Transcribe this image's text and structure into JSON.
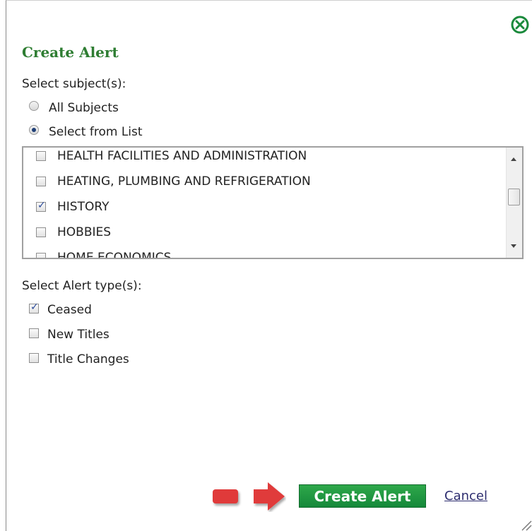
{
  "dialog": {
    "title": "Create Alert",
    "subjects_label": "Select subject(s):",
    "subject_options": [
      {
        "label": "All Subjects",
        "selected": false
      },
      {
        "label": "Select from List",
        "selected": true
      }
    ],
    "subject_list": [
      {
        "label": "HEALTH FACILITIES AND ADMINISTRATION",
        "checked": false
      },
      {
        "label": "HEATING, PLUMBING AND REFRIGERATION",
        "checked": false
      },
      {
        "label": "HISTORY",
        "checked": true
      },
      {
        "label": "HOBBIES",
        "checked": false
      },
      {
        "label": "HOME ECONOMICS",
        "checked": false
      }
    ],
    "alert_type_label": "Select Alert type(s):",
    "alert_types": [
      {
        "label": "Ceased",
        "checked": true
      },
      {
        "label": "New Titles",
        "checked": false
      },
      {
        "label": "Title Changes",
        "checked": false
      }
    ],
    "create_button": "Create Alert",
    "cancel_link": "Cancel"
  },
  "colors": {
    "title_green": "#2e7d32",
    "button_green": "#1c9a42",
    "arrow_red": "#e03a3a",
    "link_blue": "#2d2d6f"
  },
  "icons": {
    "close": "close-circle-icon",
    "resize": "resize-grip-icon"
  }
}
